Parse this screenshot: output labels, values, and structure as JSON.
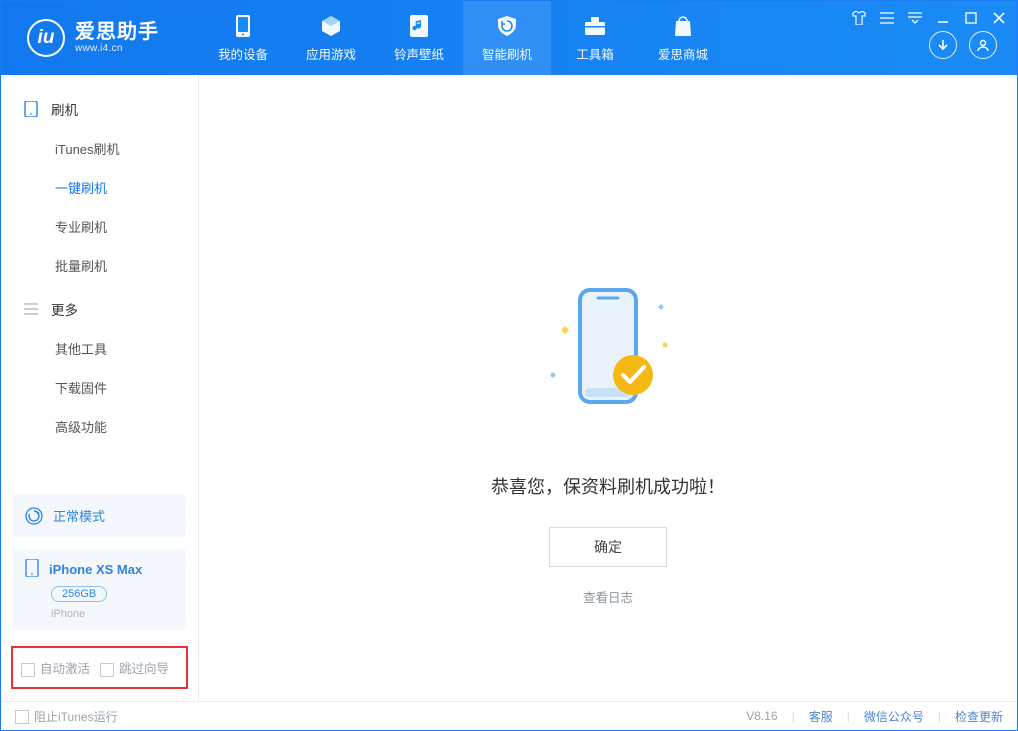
{
  "app": {
    "title": "爱思助手",
    "subtitle": "www.i4.cn"
  },
  "nav": [
    {
      "label": "我的设备"
    },
    {
      "label": "应用游戏"
    },
    {
      "label": "铃声壁纸"
    },
    {
      "label": "智能刷机",
      "active": true
    },
    {
      "label": "工具箱"
    },
    {
      "label": "爱思商城"
    }
  ],
  "sidebar": {
    "section1": {
      "title": "刷机"
    },
    "items1": [
      {
        "label": "iTunes刷机"
      },
      {
        "label": "一键刷机",
        "active": true
      },
      {
        "label": "专业刷机"
      },
      {
        "label": "批量刷机"
      }
    ],
    "section2": {
      "title": "更多"
    },
    "items2": [
      {
        "label": "其他工具"
      },
      {
        "label": "下载固件"
      },
      {
        "label": "高级功能"
      }
    ],
    "mode": {
      "label": "正常模式"
    },
    "device": {
      "name": "iPhone XS Max",
      "storage": "256GB",
      "type": "iPhone"
    },
    "options": {
      "auto_activate": "自动激活",
      "skip_guide": "跳过向导"
    }
  },
  "content": {
    "success_msg": "恭喜您，保资料刷机成功啦！",
    "ok_btn": "确定",
    "view_log": "查看日志"
  },
  "statusbar": {
    "block_itunes": "阻止iTunes运行",
    "version": "V8.16",
    "support": "客服",
    "wechat": "微信公众号",
    "check_update": "检查更新"
  }
}
